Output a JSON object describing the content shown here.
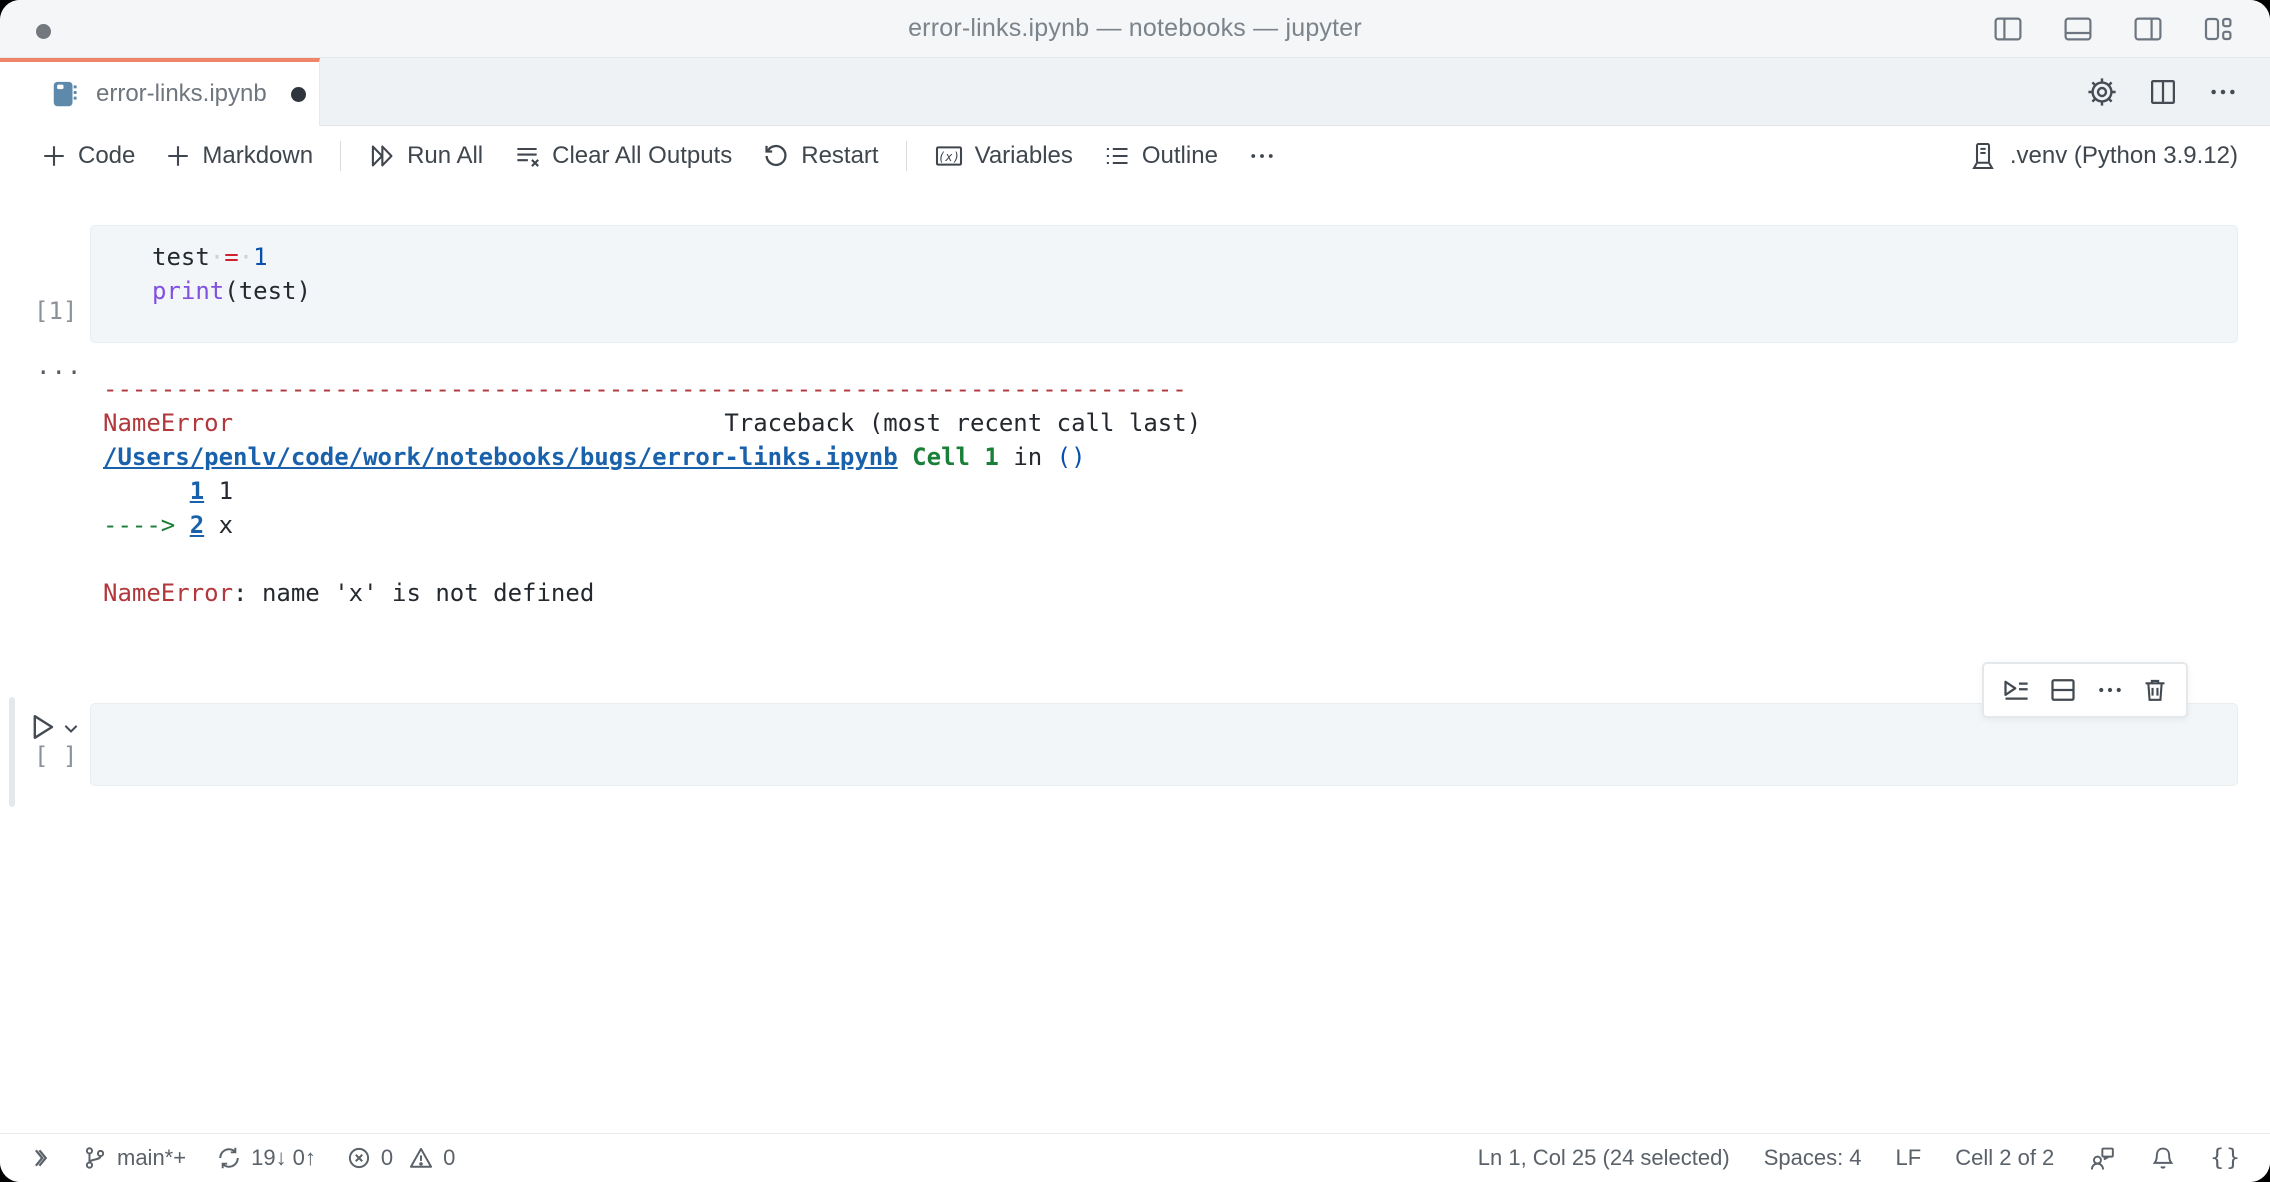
{
  "window": {
    "title": "error-links.ipynb — notebooks — jupyter"
  },
  "tab": {
    "label": "error-links.ipynb",
    "modified": true
  },
  "toolbar": {
    "code": "Code",
    "markdown": "Markdown",
    "run_all": "Run All",
    "clear_outputs": "Clear All Outputs",
    "restart": "Restart",
    "variables": "Variables",
    "outline": "Outline"
  },
  "kernel": {
    "label": ".venv (Python 3.9.12)"
  },
  "cell1": {
    "execution_count": "[1]",
    "lines": [
      [
        {
          "t": "test",
          "c": "fg"
        },
        {
          "t": "·",
          "c": "ws"
        },
        {
          "t": "=",
          "c": "op"
        },
        {
          "t": "·",
          "c": "ws"
        },
        {
          "t": "1",
          "c": "num"
        }
      ],
      [
        {
          "t": "print",
          "c": "fn"
        },
        {
          "t": "(",
          "c": "fg"
        },
        {
          "t": "test",
          "c": "fg"
        },
        {
          "t": ")",
          "c": "fg"
        }
      ]
    ]
  },
  "output": {
    "gutter": "...",
    "lines": [
      [
        {
          "t": "---------------------------------------------------------------------------",
          "c": "red"
        }
      ],
      [
        {
          "t": "NameError",
          "c": "red"
        },
        {
          "t": "                                  Traceback (most recent call last)",
          "c": "fg"
        }
      ],
      [
        {
          "t": "/Users/penlv/code/work/notebooks/bugs/error-links.ipynb",
          "c": "link"
        },
        {
          "t": " ",
          "c": "fg"
        },
        {
          "t": "Cell 1",
          "c": "green"
        },
        {
          "t": " in ",
          "c": "fg"
        },
        {
          "t": "()",
          "c": "blue"
        }
      ],
      [
        {
          "t": "      ",
          "c": "fg"
        },
        {
          "t": "1",
          "c": "link"
        },
        {
          "t": " 1",
          "c": "fg"
        }
      ],
      [
        {
          "t": "----> ",
          "c": "arrow"
        },
        {
          "t": "2",
          "c": "link"
        },
        {
          "t": " x",
          "c": "fg"
        }
      ],
      [
        {
          "t": "",
          "c": "fg"
        }
      ],
      [
        {
          "t": "NameError",
          "c": "red"
        },
        {
          "t": ": name 'x' is not defined",
          "c": "fg"
        }
      ]
    ]
  },
  "cell2": {
    "execution_count": "[ ]"
  },
  "status_bar": {
    "branch": "main*+",
    "sync": "19↓ 0↑",
    "errors": "0",
    "warnings": "0",
    "cursor": "Ln 1, Col 25 (24 selected)",
    "indent": "Spaces: 4",
    "eol": "LF",
    "cell_position": "Cell 2 of 2",
    "braces": "{}"
  },
  "icons": {
    "titlebar_right": [
      "layout-sidebar-left-icon",
      "layout-panel-icon",
      "layout-sidebar-right-icon",
      "layout-customize-icon"
    ],
    "tab": [
      "notebook-icon",
      "modified-dot"
    ],
    "tab_actions": [
      "gear-icon",
      "split-editor-icon",
      "more-actions-icon"
    ],
    "toolbar": [
      "plus-icon",
      "run-all-icon",
      "clear-outputs-icon",
      "restart-icon",
      "variables-icon",
      "outline-icon",
      "ellipsis-icon",
      "kernel-icon"
    ],
    "cell_toolbar": [
      "execute-below-icon",
      "split-cell-icon",
      "more-icon",
      "delete-icon"
    ],
    "cell_gutter": [
      "run-cell-icon",
      "chevron-down-icon"
    ],
    "status_left": [
      "remote-icon",
      "git-branch-icon",
      "sync-icon",
      "errors-icon",
      "warnings-icon"
    ],
    "status_right": [
      "feedback-icon",
      "bell-icon",
      "braces-icon"
    ]
  },
  "colors": {
    "active_tab_accent": "#ee8468",
    "error_red": "#b2383c",
    "link_blue": "#1a61ab",
    "trace_green": "#1a7f37",
    "keyword_red": "#cf222e",
    "number_blue": "#0550ae",
    "function_purple": "#8250df",
    "cell_background": "#f3f6f8",
    "tabstrip_background": "#eff2f4"
  }
}
